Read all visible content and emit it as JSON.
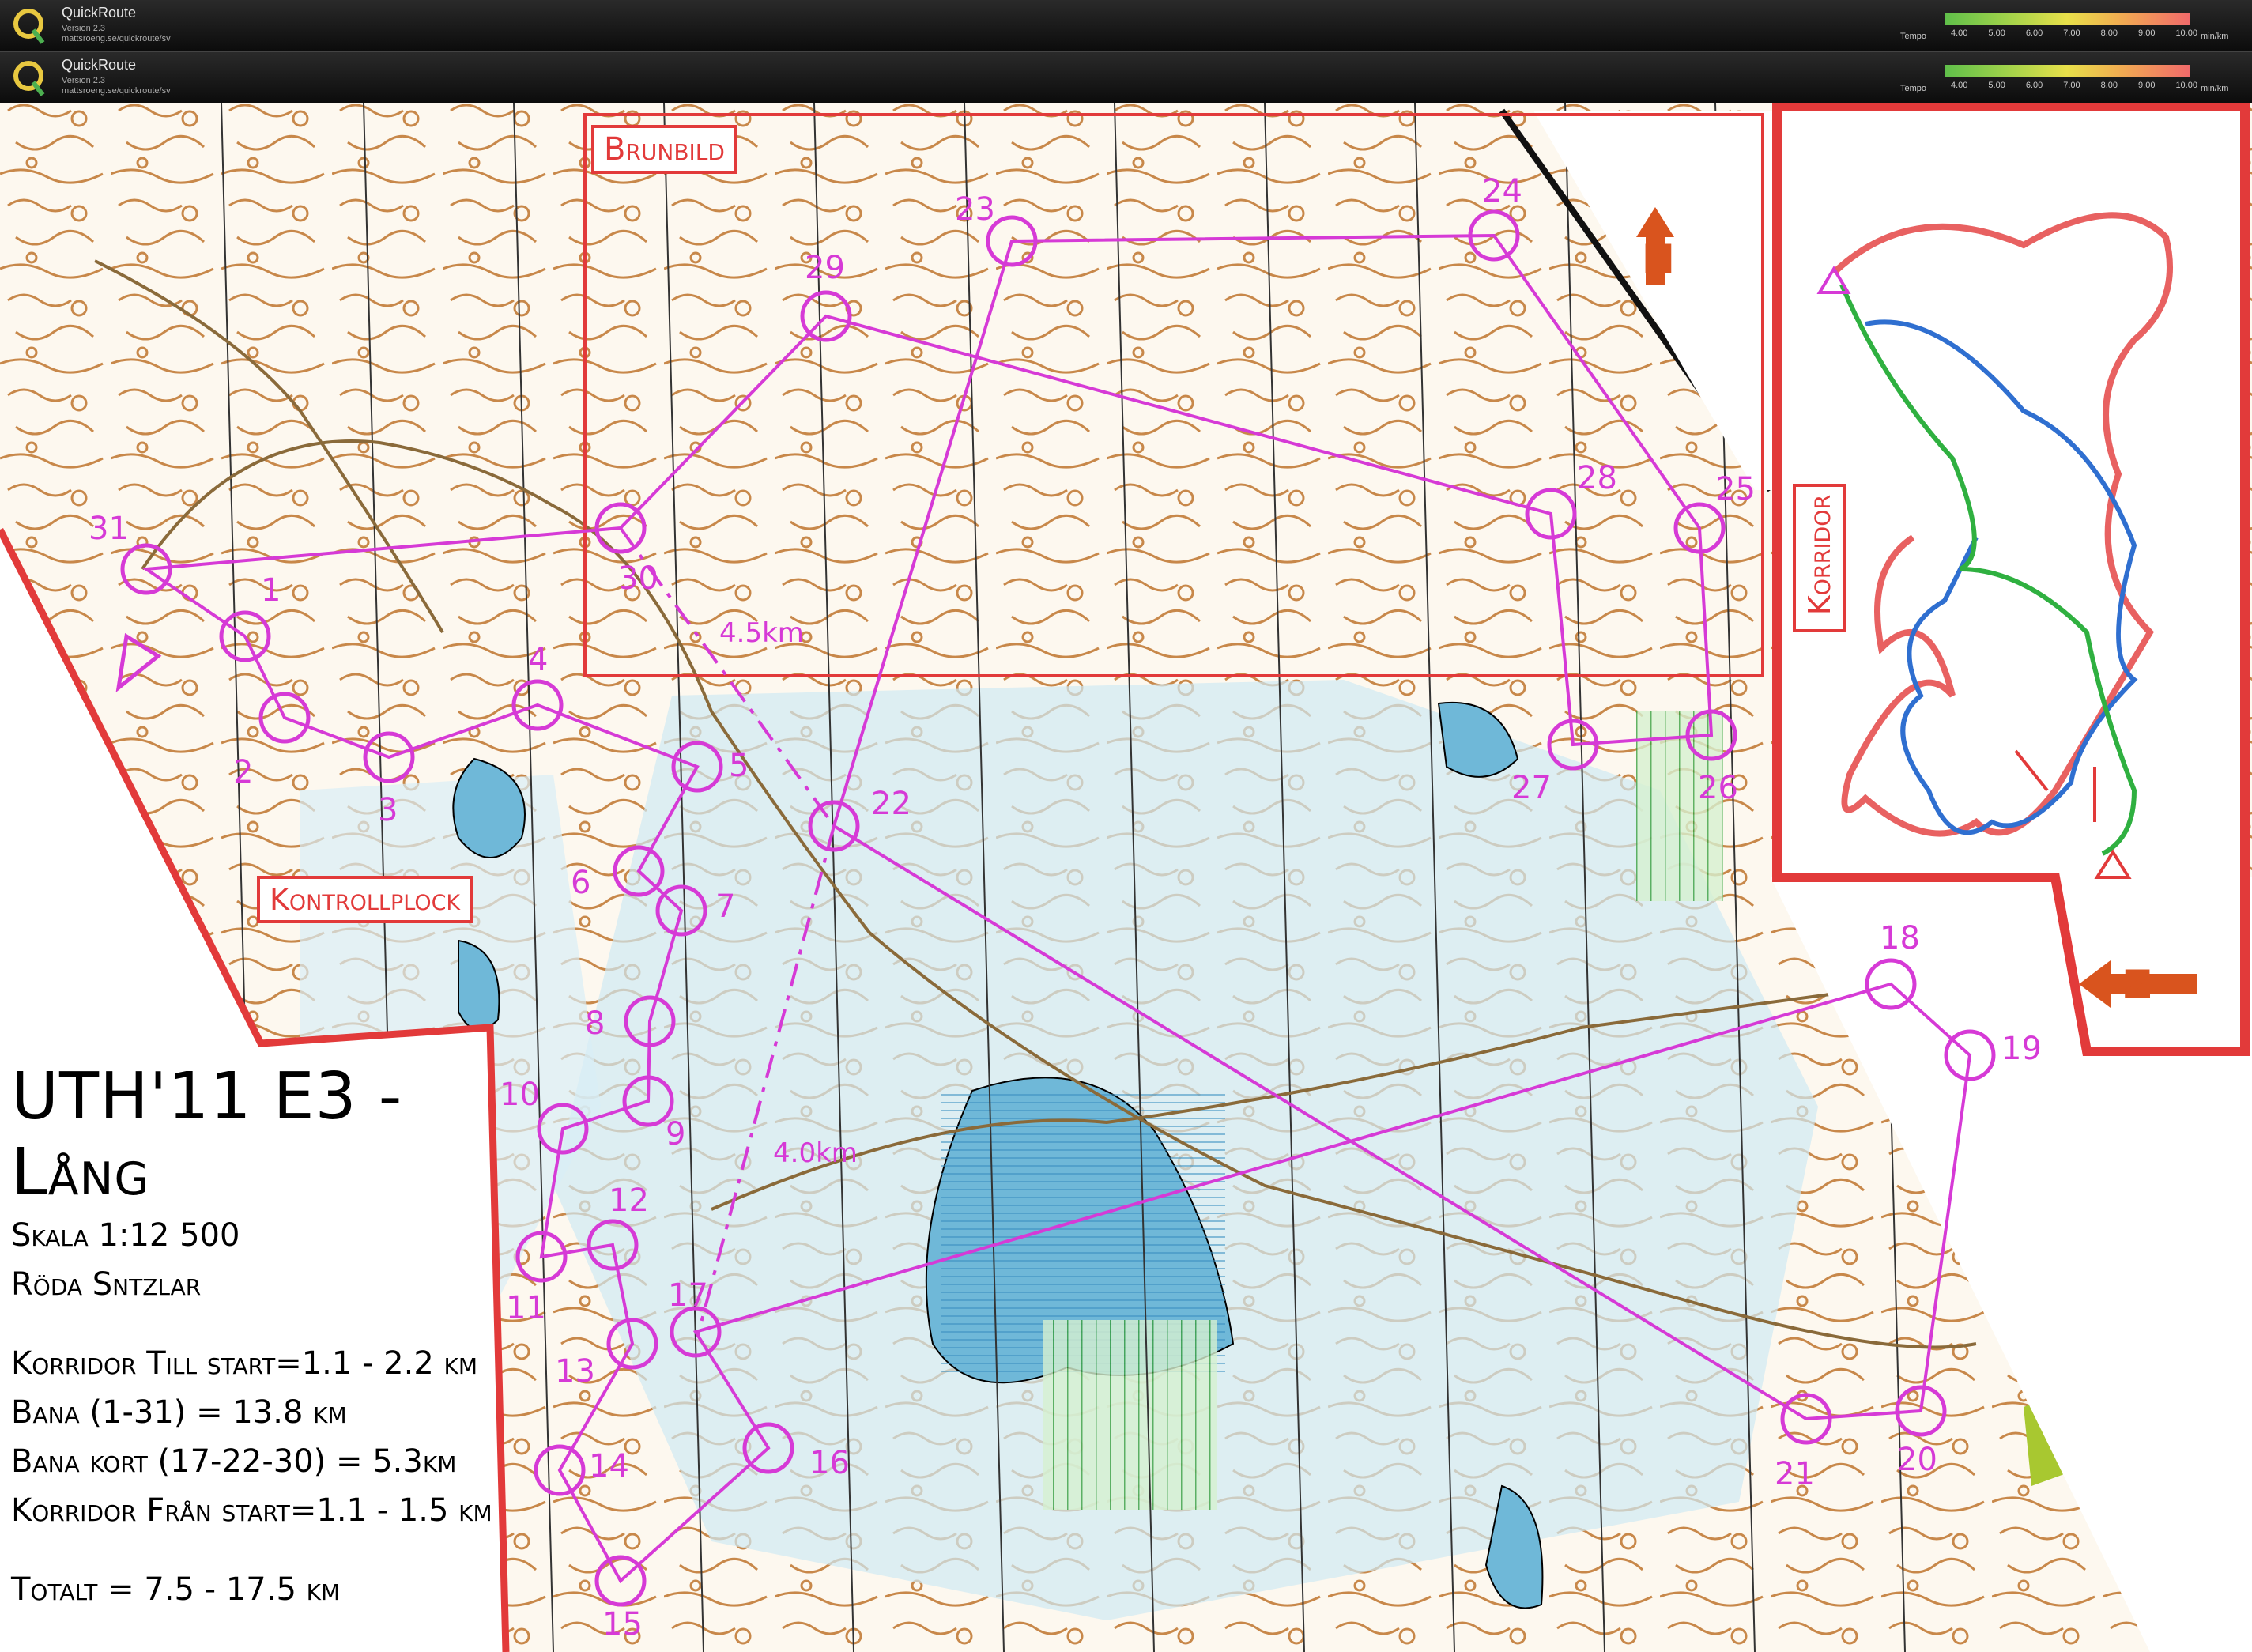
{
  "app": {
    "name": "QuickRoute",
    "version_line": "Version 2.3",
    "url_line": "mattsroeng.se/quickroute/sv"
  },
  "tempo_legend": {
    "label": "Tempo",
    "ticks": [
      "4.00",
      "5.00",
      "6.00",
      "7.00",
      "8.00",
      "9.00",
      "10.00"
    ],
    "unit": "min/km"
  },
  "map": {
    "title": "UTH'11 E3 - Lång",
    "info_lines": [
      "Skala 1:12 500",
      "Röda Sntzlar",
      "",
      "Korridor Till start=1.1 - 2.2 km",
      "Bana (1-31) = 13.8 km",
      "Bana kort (17-22-30) = 5.3km",
      "Korridor Från start=1.1 - 1.5 km",
      "",
      "Totalt = 7.5 - 17.5 km"
    ],
    "box_labels": {
      "brunbild": "Brunbild",
      "kontrollplock": "Kontrollplock",
      "korridor": "Korridor"
    },
    "distance_labels": [
      "4.5km",
      "4.0km"
    ],
    "controls": [
      "1",
      "2",
      "3",
      "4",
      "5",
      "6",
      "7",
      "8",
      "9",
      "10",
      "11",
      "12",
      "13",
      "14",
      "15",
      "16",
      "17",
      "18",
      "19",
      "20",
      "21",
      "22",
      "23",
      "24",
      "25",
      "26",
      "27",
      "28",
      "29",
      "30",
      "31"
    ],
    "colors": {
      "course": "#d63ad6",
      "frame_red": "#e23a3a",
      "arrow_orange": "#d9541e",
      "contour": "#c8884a",
      "water": "#6fb8d8",
      "vegetation": "#7fd07a"
    }
  }
}
